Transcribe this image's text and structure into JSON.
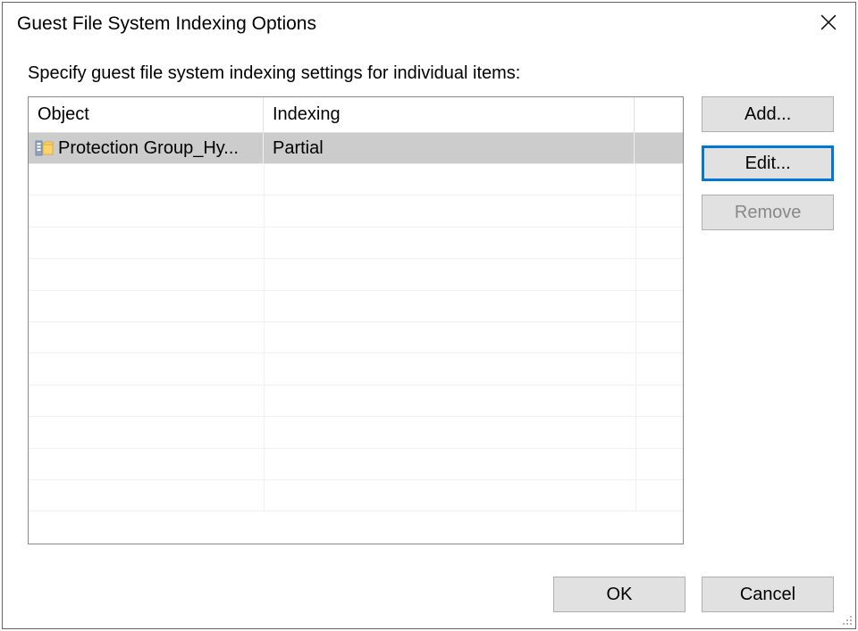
{
  "title": "Guest File System Indexing Options",
  "instruction": "Specify guest file system indexing settings for individual items:",
  "columns": {
    "object": "Object",
    "indexing": "Indexing"
  },
  "rows": [
    {
      "object": "Protection Group_Hy...",
      "indexing": "Partial"
    }
  ],
  "buttons": {
    "add": "Add...",
    "edit": "Edit...",
    "remove": "Remove",
    "ok": "OK",
    "cancel": "Cancel"
  }
}
